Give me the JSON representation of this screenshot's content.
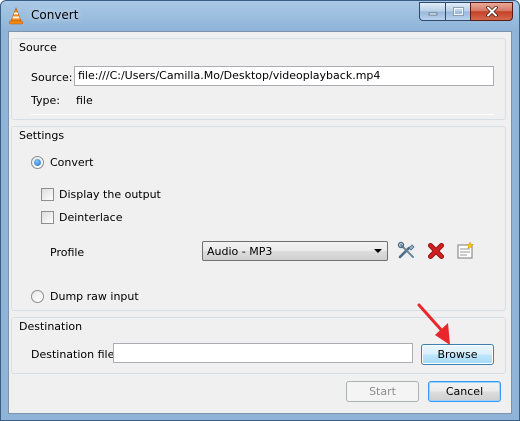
{
  "window": {
    "title": "Convert",
    "icon": "vlc-cone-icon"
  },
  "source": {
    "group_title": "Source",
    "source_label": "Source:",
    "source_value": "file:///C:/Users/Camilla.Mo/Desktop/videoplayback.mp4",
    "type_label": "Type:",
    "type_value": "file"
  },
  "settings": {
    "group_title": "Settings",
    "convert_label": "Convert",
    "convert_checked": true,
    "display_output_label": "Display the output",
    "display_output_checked": false,
    "deinterlace_label": "Deinterlace",
    "deinterlace_checked": false,
    "profile_label": "Profile",
    "profile_selected": "Audio - MP3",
    "dump_raw_label": "Dump raw input",
    "dump_raw_checked": false
  },
  "destination": {
    "group_title": "Destination",
    "file_label": "Destination file:",
    "file_value": "",
    "browse_label": "Browse"
  },
  "footer": {
    "start_label": "Start",
    "cancel_label": "Cancel"
  },
  "colors": {
    "annotation_arrow": "#e8262c",
    "delete_profile": "#d21f1f",
    "focus_border": "#3c7fb1"
  }
}
